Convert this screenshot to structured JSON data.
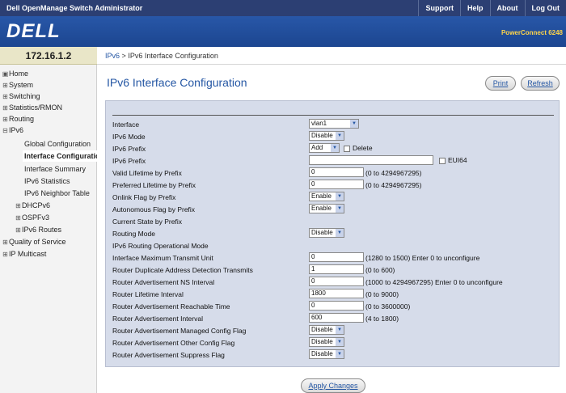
{
  "topbar": {
    "app_title": "Dell OpenManage Switch Administrator",
    "links": [
      "Support",
      "Help",
      "About",
      "Log Out"
    ]
  },
  "header": {
    "logo": "DELL",
    "model": "PowerConnect 6248"
  },
  "ip_address": "172.16.1.2",
  "breadcrumb": {
    "parent": "IPv6",
    "separator": ">",
    "current": "IPv6 Interface Configuration"
  },
  "sidebar": {
    "items": [
      {
        "label": "Home",
        "icon": "home-icon"
      },
      {
        "label": "System",
        "icon": "expand-icon"
      },
      {
        "label": "Switching",
        "icon": "expand-icon"
      },
      {
        "label": "Statistics/RMON",
        "icon": "expand-icon"
      },
      {
        "label": "Routing",
        "icon": "expand-icon"
      },
      {
        "label": "IPv6",
        "icon": "collapse-icon"
      },
      {
        "label": "Global Configuration"
      },
      {
        "label": "Interface Configuration"
      },
      {
        "label": "Interface Summary"
      },
      {
        "label": "IPv6 Statistics"
      },
      {
        "label": "IPv6 Neighbor Table"
      },
      {
        "label": "DHCPv6",
        "icon": "expand-icon"
      },
      {
        "label": "OSPFv3",
        "icon": "expand-icon"
      },
      {
        "label": "IPv6 Routes",
        "icon": "expand-icon"
      },
      {
        "label": "Quality of Service",
        "icon": "expand-icon"
      },
      {
        "label": "IP Multicast",
        "icon": "expand-icon"
      }
    ]
  },
  "page": {
    "title": "IPv6 Interface Configuration",
    "print": "Print",
    "refresh": "Refresh",
    "apply": "Apply Changes"
  },
  "form": {
    "interface": {
      "label": "Interface",
      "value": "vlan1"
    },
    "mode": {
      "label": "IPv6 Mode",
      "value": "Disable"
    },
    "prefix_action": {
      "label": "IPv6 Prefix",
      "value": "Add",
      "delete": "Delete"
    },
    "prefix": {
      "label": "IPv6 Prefix",
      "value": "",
      "eui64": "EUI64"
    },
    "valid_lifetime": {
      "label": "Valid Lifetime by Prefix",
      "value": "0",
      "hint": "(0 to 4294967295)"
    },
    "preferred_lifetime": {
      "label": "Preferred Lifetime by Prefix",
      "value": "0",
      "hint": "(0 to 4294967295)"
    },
    "onlink": {
      "label": "Onlink Flag by Prefix",
      "value": "Enable"
    },
    "autonomous": {
      "label": "Autonomous Flag by Prefix",
      "value": "Enable"
    },
    "current_state": {
      "label": "Current State by Prefix"
    },
    "routing_mode": {
      "label": "Routing Mode",
      "value": "Disable"
    },
    "routing_oper": {
      "label": "IPv6 Routing Operational Mode"
    },
    "mtu": {
      "label": "Interface Maximum Transmit Unit",
      "value": "0",
      "hint": "(1280 to 1500) Enter 0 to unconfigure"
    },
    "dad": {
      "label": "Router Duplicate Address Detection Transmits",
      "value": "1",
      "hint": "(0 to 600)"
    },
    "ns_interval": {
      "label": "Router Advertisement NS Interval",
      "value": "0",
      "hint": "(1000 to 4294967295) Enter 0 to unconfigure"
    },
    "lifetime": {
      "label": "Router Lifetime Interval",
      "value": "1800",
      "hint": "(0 to 9000)"
    },
    "reachable": {
      "label": "Router Advertisement Reachable Time",
      "value": "0",
      "hint": "(0 to 3600000)"
    },
    "adv_interval": {
      "label": "Router Advertisement Interval",
      "value": "600",
      "hint": "(4 to 1800)"
    },
    "managed": {
      "label": "Router Advertisement Managed Config Flag",
      "value": "Disable"
    },
    "other": {
      "label": "Router Advertisement Other Config Flag",
      "value": "Disable"
    },
    "suppress": {
      "label": "Router Advertisement Suppress Flag",
      "value": "Disable"
    }
  }
}
